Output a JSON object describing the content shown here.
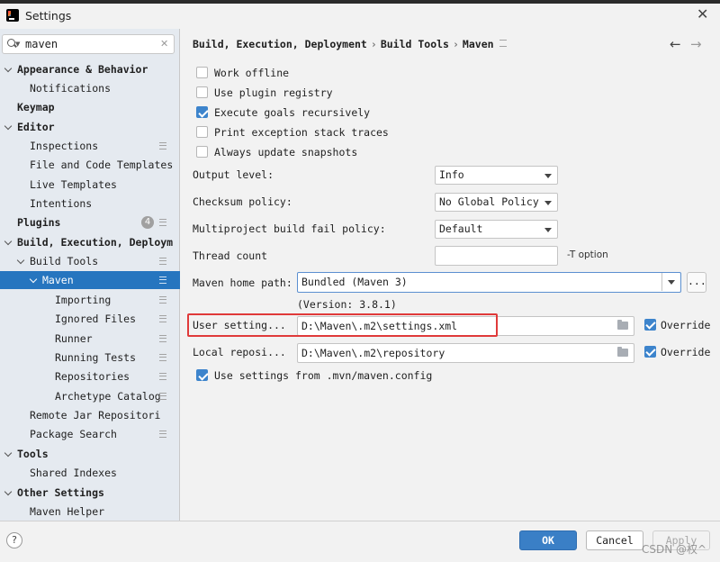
{
  "window": {
    "title": "Settings"
  },
  "search": {
    "value": "maven"
  },
  "sidebar": {
    "items": [
      {
        "label": "Appearance & Behavior"
      },
      {
        "label": "Notifications"
      },
      {
        "label": "Keymap"
      },
      {
        "label": "Editor"
      },
      {
        "label": "Inspections"
      },
      {
        "label": "File and Code Templates"
      },
      {
        "label": "Live Templates"
      },
      {
        "label": "Intentions"
      },
      {
        "label": "Plugins",
        "badge": "4"
      },
      {
        "label": "Build, Execution, Deploym"
      },
      {
        "label": "Build Tools"
      },
      {
        "label": "Maven"
      },
      {
        "label": "Importing"
      },
      {
        "label": "Ignored Files"
      },
      {
        "label": "Runner"
      },
      {
        "label": "Running Tests"
      },
      {
        "label": "Repositories"
      },
      {
        "label": "Archetype Catalog"
      },
      {
        "label": "Remote Jar Repositori"
      },
      {
        "label": "Package Search"
      },
      {
        "label": "Tools"
      },
      {
        "label": "Shared Indexes"
      },
      {
        "label": "Other Settings"
      },
      {
        "label": "Maven Helper"
      }
    ]
  },
  "breadcrumb": {
    "part1": "Build, Execution, Deployment",
    "part2": "Build Tools",
    "part3": "Maven",
    "sep": "›"
  },
  "nav": {
    "back": "←",
    "forward": "→"
  },
  "options": {
    "work_offline": "Work offline",
    "use_plugin_registry": "Use plugin registry",
    "execute_goals": "Execute goals recursively",
    "print_stack": "Print exception stack traces",
    "always_update": "Always update snapshots"
  },
  "settings": {
    "output_level_label": "Output level:",
    "output_level_value": "Info",
    "checksum_label": "Checksum policy:",
    "checksum_value": "No Global Policy",
    "multiproject_label": "Multiproject build fail policy:",
    "multiproject_value": "Default",
    "thread_label": "Thread count",
    "thread_value": "",
    "thread_hint": "-T option",
    "home_label": "Maven home path:",
    "home_value": "Bundled (Maven 3)",
    "version": "(Version: 3.8.1)",
    "more_label": "...",
    "user_settings_label": "User setting...",
    "user_settings_value": "D:\\Maven\\.m2\\settings.xml",
    "local_repo_label": "Local reposi...",
    "local_repo_value": "D:\\Maven\\.m2\\repository",
    "override_label": "Override",
    "use_mvn_config": "Use settings from .mvn/maven.config"
  },
  "footer": {
    "help": "?",
    "ok": "OK",
    "cancel": "Cancel",
    "apply": "Apply",
    "watermark": "CSDN @权^"
  },
  "colors": {
    "accent": "#3a7fc6",
    "selection": "#2675bf",
    "highlight": "#e03a3a"
  }
}
